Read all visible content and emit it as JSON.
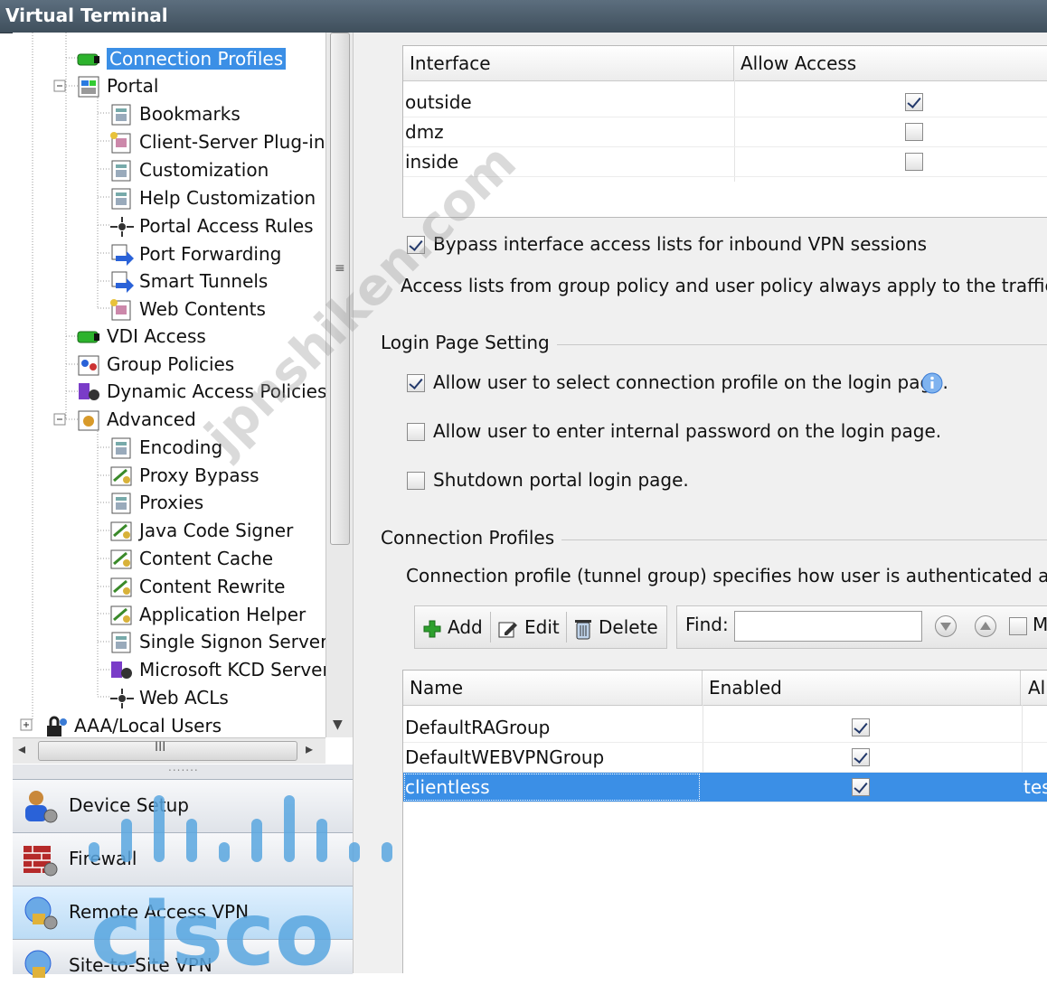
{
  "window": {
    "title": "Virtual Terminal"
  },
  "tree": {
    "items": [
      {
        "label": "Connection Profiles",
        "selected": true,
        "icon": "connection-profile-icon"
      },
      {
        "label": "Portal",
        "expand": "-",
        "icon": "portal-icon"
      },
      {
        "label": "Bookmarks",
        "icon": "page-icon"
      },
      {
        "label": "Client-Server Plug-ins",
        "icon": "plugin-icon"
      },
      {
        "label": "Customization",
        "icon": "page-icon"
      },
      {
        "label": "Help Customization",
        "icon": "page-icon"
      },
      {
        "label": "Portal Access Rules",
        "icon": "access-rules-icon"
      },
      {
        "label": "Port Forwarding",
        "icon": "port-forwarding-icon"
      },
      {
        "label": "Smart Tunnels",
        "icon": "smart-tunnels-icon"
      },
      {
        "label": "Web Contents",
        "icon": "plugin-icon"
      },
      {
        "label": "VDI Access",
        "icon": "connection-profile-icon"
      },
      {
        "label": "Group Policies",
        "icon": "group-policies-icon"
      },
      {
        "label": "Dynamic Access Policies",
        "icon": "dynamic-access-icon"
      },
      {
        "label": "Advanced",
        "expand": "-",
        "icon": "advanced-icon"
      },
      {
        "label": "Encoding",
        "icon": "page-icon"
      },
      {
        "label": "Proxy Bypass",
        "icon": "certificate-icon"
      },
      {
        "label": "Proxies",
        "icon": "page-icon"
      },
      {
        "label": "Java Code Signer",
        "icon": "certificate-icon"
      },
      {
        "label": "Content Cache",
        "icon": "certificate-icon"
      },
      {
        "label": "Content Rewrite",
        "icon": "certificate-icon"
      },
      {
        "label": "Application Helper",
        "icon": "certificate-icon"
      },
      {
        "label": "Single Signon Servers",
        "icon": "page-icon"
      },
      {
        "label": "Microsoft KCD Server",
        "icon": "kcd-server-icon"
      },
      {
        "label": "Web ACLs",
        "icon": "access-rules-icon"
      },
      {
        "label": "AAA/Local Users",
        "expand": "+",
        "icon": "lock-icon"
      }
    ],
    "hscroll_grip": "III"
  },
  "nav": {
    "buttons": [
      {
        "label": "Device Setup",
        "icon": "device-setup-icon"
      },
      {
        "label": "Firewall",
        "icon": "firewall-icon"
      },
      {
        "label": "Remote Access VPN",
        "icon": "remote-access-vpn-icon",
        "active": true
      },
      {
        "label": "Site-to-Site VPN",
        "icon": "site-to-site-vpn-icon"
      }
    ]
  },
  "access": {
    "columns": [
      "Interface",
      "Allow Access"
    ],
    "rows": [
      {
        "interface": "outside",
        "allow": true
      },
      {
        "interface": "dmz",
        "allow": false
      },
      {
        "interface": "inside",
        "allow": false
      }
    ],
    "bypass_label": "Bypass interface access lists for inbound VPN sessions",
    "bypass_checked": true,
    "note": "Access lists from group policy and user policy always apply to the traffic."
  },
  "login": {
    "title": "Login Page Setting",
    "options": [
      {
        "label": "Allow user to select connection profile on the login page.",
        "checked": true
      },
      {
        "label": "Allow user to enter internal password on the login page.",
        "checked": false
      },
      {
        "label": "Shutdown portal login page.",
        "checked": false
      }
    ]
  },
  "profiles": {
    "title": "Connection Profiles",
    "description": "Connection profile (tunnel group) specifies how user is authenticated and oth",
    "toolbar": {
      "add": "Add",
      "edit": "Edit",
      "delete": "Delete"
    },
    "find": {
      "label": "Find:",
      "value": "",
      "match_label": "M"
    },
    "columns": [
      "Name",
      "Enabled",
      "Ali"
    ],
    "rows": [
      {
        "name": "DefaultRAGroup",
        "enabled": true,
        "aliases": "",
        "selected": false
      },
      {
        "name": "DefaultWEBVPNGroup",
        "enabled": true,
        "aliases": "",
        "selected": false
      },
      {
        "name": "clientless",
        "enabled": true,
        "aliases": "tes",
        "selected": true
      }
    ]
  },
  "watermark": {
    "site": "jpnshiken.com",
    "brand": "cisco"
  },
  "colors": {
    "selection": "#3b8fe6",
    "titlebar": "#4a5a68",
    "watermark": "#5aa7e0"
  }
}
